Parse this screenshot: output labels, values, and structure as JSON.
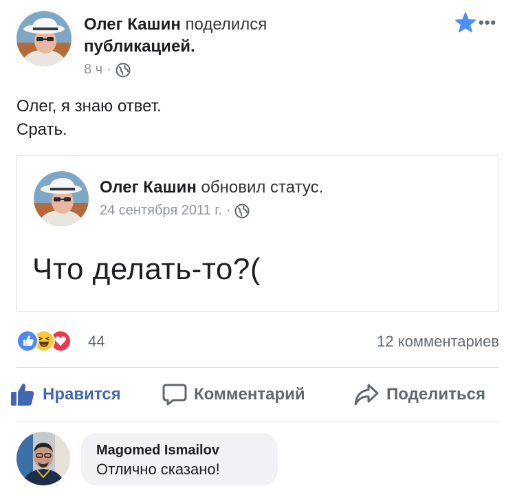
{
  "post": {
    "author": "Олег Кашин",
    "action_text": "поделился",
    "action_object": "публикацией",
    "time": "8 ч",
    "separator": "·",
    "text_line1": "Олег, я знаю ответ.",
    "text_line2": "Срать."
  },
  "shared_post": {
    "author": "Олег Кашин",
    "action_text": "обновил статус.",
    "date": "24 сентября 2011 г.",
    "separator": "·",
    "text": "Что делать-то?("
  },
  "stats": {
    "reactions_count": "44",
    "comments_count": "12 комментариев"
  },
  "actions": {
    "like_label": "Нравится",
    "comment_label": "Комментарий",
    "share_label": "Поделиться"
  },
  "comment": {
    "author": "Magomed Ismailov",
    "text": "Отлично сказано!"
  },
  "colors": {
    "accent": "#4267b2",
    "star": "#4f8ff7",
    "like_reaction": "#4a8af4",
    "haha_reaction": "#f7c935",
    "love_reaction": "#f0364f"
  },
  "icons": [
    "star-icon",
    "more-icon",
    "globe-icon",
    "like-reaction-icon",
    "haha-reaction-icon",
    "love-reaction-icon",
    "thumbs-up-icon",
    "comment-bubble-icon",
    "share-arrow-icon"
  ]
}
